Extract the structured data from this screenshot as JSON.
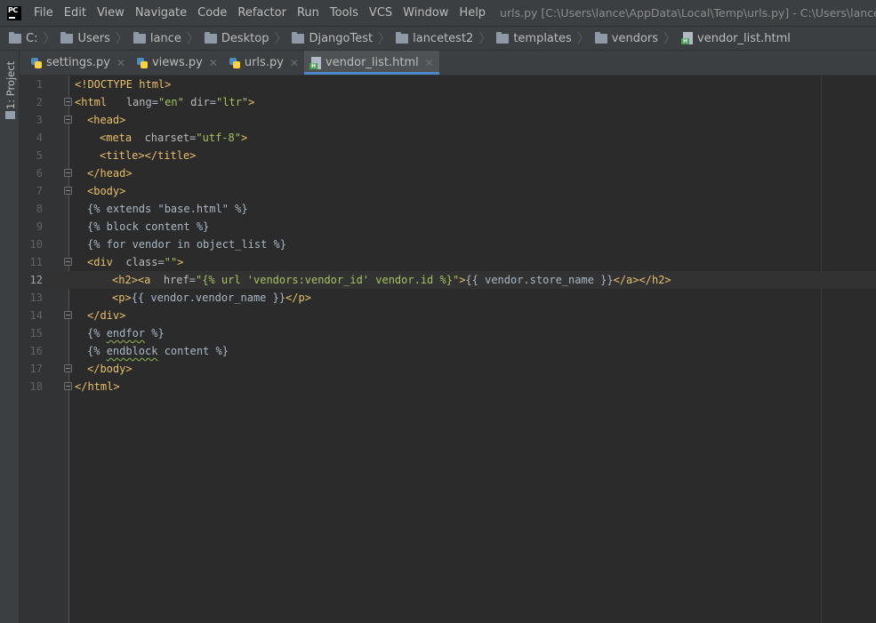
{
  "app": {
    "logo_text": "PC"
  },
  "menu": [
    "File",
    "Edit",
    "View",
    "Navigate",
    "Code",
    "Refactor",
    "Run",
    "Tools",
    "VCS",
    "Window",
    "Help"
  ],
  "window_title": "urls.py [C:\\Users\\lance\\AppData\\Local\\Temp\\urls.py] - C:\\Users\\lance\\Desktop\\Dja",
  "breadcrumb": [
    "C:",
    "Users",
    "lance",
    "Desktop",
    "DjangoTest",
    "lancetest2",
    "templates",
    "vendors",
    "vendor_list.html"
  ],
  "toolstrip": {
    "project_label": "1: Project"
  },
  "tabs": [
    {
      "label": "settings.py",
      "type": "python"
    },
    {
      "label": "views.py",
      "type": "python"
    },
    {
      "label": "urls.py",
      "type": "python"
    },
    {
      "label": "vendor_list.html",
      "type": "html",
      "active": true
    }
  ],
  "editor": {
    "current_line": 12,
    "lines": [
      {
        "n": "1",
        "text": "<!DOCTYPE html>"
      },
      {
        "n": "2",
        "text": "<html lang=\"en\" dir=\"ltr\">"
      },
      {
        "n": "3",
        "text": "<head>"
      },
      {
        "n": "4",
        "text": "<meta charset=\"utf-8\">"
      },
      {
        "n": "5",
        "text": "<title></title>"
      },
      {
        "n": "6",
        "text": "</head>"
      },
      {
        "n": "7",
        "text": "<body>"
      },
      {
        "n": "8",
        "text": "{% extends \"base.html\" %}"
      },
      {
        "n": "9",
        "text": "{% block content %}"
      },
      {
        "n": "10",
        "text": "{% for vendor in object_list %}"
      },
      {
        "n": "11",
        "text": "<div class=\"\">"
      },
      {
        "n": "12",
        "text": "<h2><a href=\"{% url 'vendors:vendor_id' vendor.id %}\">{{ vendor.store_name }}</a></h2>"
      },
      {
        "n": "13",
        "text": "<p>{{ vendor.vendor_name }}</p>"
      },
      {
        "n": "14",
        "text": "</div>"
      },
      {
        "n": "15",
        "text": "{% endfor %}"
      },
      {
        "n": "16",
        "text": "{% endblock content %}"
      },
      {
        "n": "17",
        "text": "</body>"
      },
      {
        "n": "18",
        "text": "</html>"
      }
    ]
  },
  "colors": {
    "tag": "#e8bf6a",
    "attribute": "#bababa",
    "string": "#a5c261",
    "text": "#a9b7c6",
    "background": "#2b2b2b",
    "accent": "#4a88c7"
  }
}
